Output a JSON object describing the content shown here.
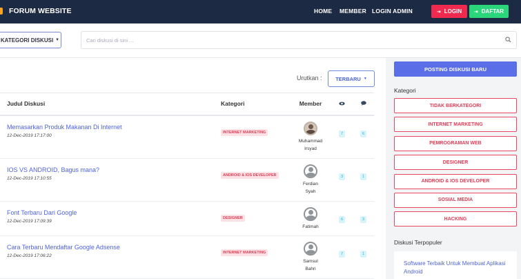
{
  "navbar": {
    "brand": "FORUM WEBSITE",
    "links": [
      "HOME",
      "MEMBER",
      "LOGIN ADMIN"
    ],
    "login_label": "LOGIN",
    "daftar_label": "DAFTAR",
    "colors": {
      "bg": "#1d2a44",
      "login": "#f0294e",
      "daftar": "#2bd67b"
    }
  },
  "search": {
    "kategori_label": "KATEGORI DISKUSI",
    "placeholder": "Cari diskusi di sini ..."
  },
  "main": {
    "sort_label": "Urutkan :",
    "sort_value": "TERBARU",
    "table": {
      "headers": {
        "title": "Judul Diskusi",
        "kategori": "Kategori",
        "member": "Member",
        "views_icon": "eye-icon",
        "comments_icon": "comment-icon"
      },
      "rows": [
        {
          "title": "Memasarkan Produk Makanan Di Internet",
          "date": "12-Dec-2019 17:17:00",
          "kategori": "INTERNET MARKETING",
          "member_line1": "Muhammad",
          "member_line2": "Irsyad",
          "views": "7",
          "comments": "6"
        },
        {
          "title": "IOS VS ANDROID, Bagus mana?",
          "date": "12-Dec-2019 17:10:55",
          "kategori": "ANDROID & IOS DEVELOPER",
          "member_line1": "Ferdian",
          "member_line2": "Syah",
          "views": "3",
          "comments": "1"
        },
        {
          "title": "Font Terbaru Dari Google",
          "date": "12-Dec-2019 17:09:39",
          "kategori": "DESIGNER",
          "member_line1": "Fatimah",
          "member_line2": "",
          "views": "6",
          "comments": "3"
        },
        {
          "title": "Cara Terbaru Mendaftar Google Adsense",
          "date": "12-Dec-2019 17:06:22",
          "kategori": "INTERNET MARKETING",
          "member_line1": "Samsul",
          "member_line2": "Bahri",
          "views": "7",
          "comments": "1"
        }
      ]
    }
  },
  "sidebar": {
    "post_button": "POSTING DISKUSI BARU",
    "kategori_heading": "Kategori",
    "categories": [
      "TIDAK BERKATEGORI",
      "INTERNET MARKETING",
      "PEMROGRAMAN WEB",
      "DESIGNER",
      "ANDROID & IOS DEVELOPER",
      "SOSIAL MEDIA",
      "HACKING"
    ],
    "popular_heading": "Diskusi Terpopuler",
    "popular_item": "Software Terbaik Untuk Membuat Aplikasi Android"
  }
}
